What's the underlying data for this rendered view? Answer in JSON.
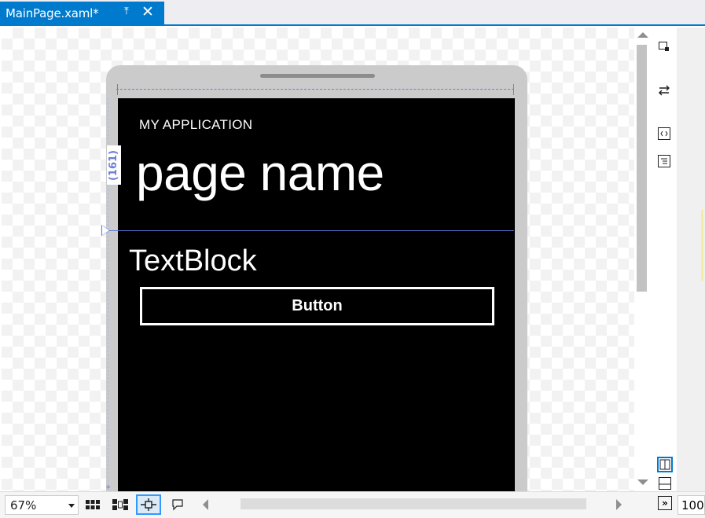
{
  "tab": {
    "title": "MainPage.xaml*",
    "pin_icon": "pin-icon",
    "close_icon": "close-icon"
  },
  "phone": {
    "app_title": "MY APPLICATION",
    "page_name": "page name",
    "textblock": "TextBlock",
    "button_label": "Button"
  },
  "adorners": {
    "row_height_label": "(161)",
    "star_marker": "*"
  },
  "toolbar": {
    "zoom": "67%",
    "zoom_right": "100"
  },
  "colors": {
    "accent": "#007acc",
    "guide": "#6a7fd4",
    "screen": "#000000"
  }
}
